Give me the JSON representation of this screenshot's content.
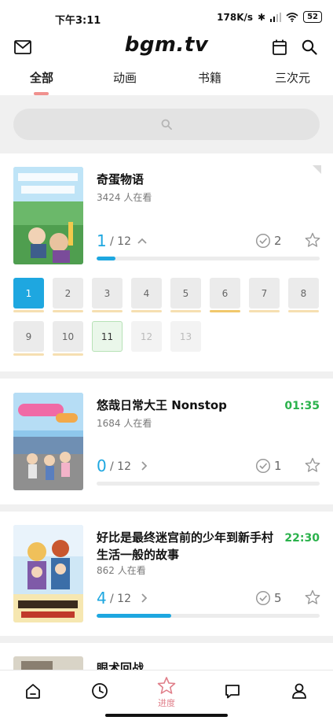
{
  "status_bar": {
    "time": "下午3:11",
    "speed": "178K/s",
    "battery": "52"
  },
  "app_bar": {
    "logo": "bgm.tv"
  },
  "tabs": [
    {
      "label": "全部",
      "active": true
    },
    {
      "label": "动画",
      "active": false
    },
    {
      "label": "书籍",
      "active": false
    },
    {
      "label": "三次元",
      "active": false
    }
  ],
  "colors": {
    "accent_pink": "#f0918e",
    "progress_blue": "#1ea7e0",
    "air_green": "#2bb24c"
  },
  "cards": [
    {
      "title": "奇蛋物语",
      "watchers": "3424 人在看",
      "air_time": "",
      "progress_current": "1",
      "progress_total": "/ 12",
      "progress_fraction": 0.083,
      "done_count": "2",
      "chevron": "chevron-up-icon",
      "episodes": [
        "1",
        "2",
        "3",
        "4",
        "5",
        "6",
        "7",
        "8",
        "9",
        "10",
        "11",
        "12",
        "13"
      ]
    },
    {
      "title": "悠哉日常大王 Nonstop",
      "watchers": "1684 人在看",
      "air_time": "01:35",
      "progress_current": "0",
      "progress_total": "/ 12",
      "progress_fraction": 0,
      "done_count": "1",
      "chevron": "chevron-right-icon"
    },
    {
      "title_line1": "好比是最终迷宫前的少年到新手村",
      "title_line2": "生活一般的故事",
      "watchers": "862 人在看",
      "air_time": "22:30",
      "progress_current": "4",
      "progress_total": "/ 12",
      "progress_fraction": 0.333,
      "done_count": "5",
      "chevron": "chevron-right-icon"
    },
    {
      "title": "眼术回战"
    }
  ],
  "bottom_nav": {
    "active_label": "进度"
  }
}
